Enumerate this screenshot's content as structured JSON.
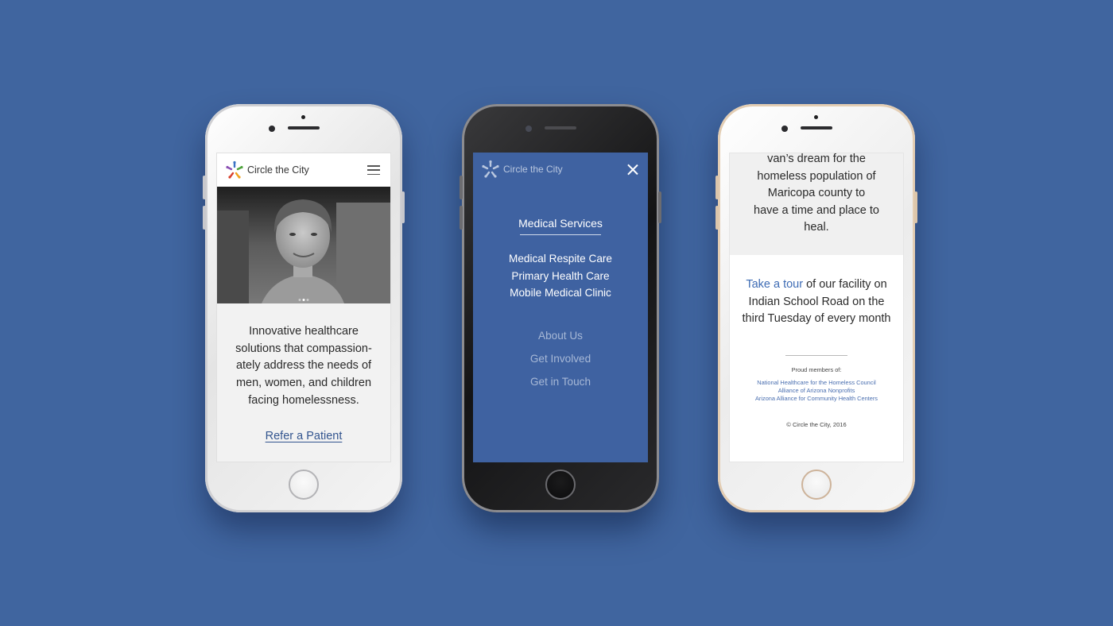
{
  "colors": {
    "background": "#40659f",
    "menu_blue": "#3f62a1",
    "link_blue": "#33558f",
    "logo_colors": [
      "#d8402c",
      "#f0a21d",
      "#4ea33b",
      "#3a72c4",
      "#8a4fb3"
    ]
  },
  "phone_left": {
    "brand": "Circle the City",
    "menu_icon": "hamburger-menu-icon",
    "hero_image": "black-and-white portrait photo",
    "carousel_dots": 3,
    "carousel_active": 2,
    "tagline": "Innovative healthcare solutions that compassion-ately address the needs of men, women, and children facing homelessness.",
    "refer_link": "Refer a Patient"
  },
  "phone_middle": {
    "brand": "Circle the City",
    "close_icon": "close-icon",
    "menu_heading": "Medical Services",
    "submenu": [
      "Medical Respite Care",
      "Primary Health Care",
      "Mobile Medical Clinic"
    ],
    "secondary": [
      "About Us",
      "Get Involved",
      "Get in Touch"
    ]
  },
  "phone_right": {
    "quote_lines": [
      "van’s dream for the",
      "homeless population of",
      "Maricopa county to",
      "have a time and place to",
      "heal."
    ],
    "tour_link": "Take a tour",
    "tour_text": " of our facility on Indian School Road on the third Tuesday of every month",
    "proud_label": "Proud members of:",
    "orgs": [
      "National Healthcare for the Homeless Council",
      "Alliance of Arizona Nonprofits",
      "Arizona Alliance for Community Health Centers"
    ],
    "copyright": "© Circle the City, 2016"
  }
}
